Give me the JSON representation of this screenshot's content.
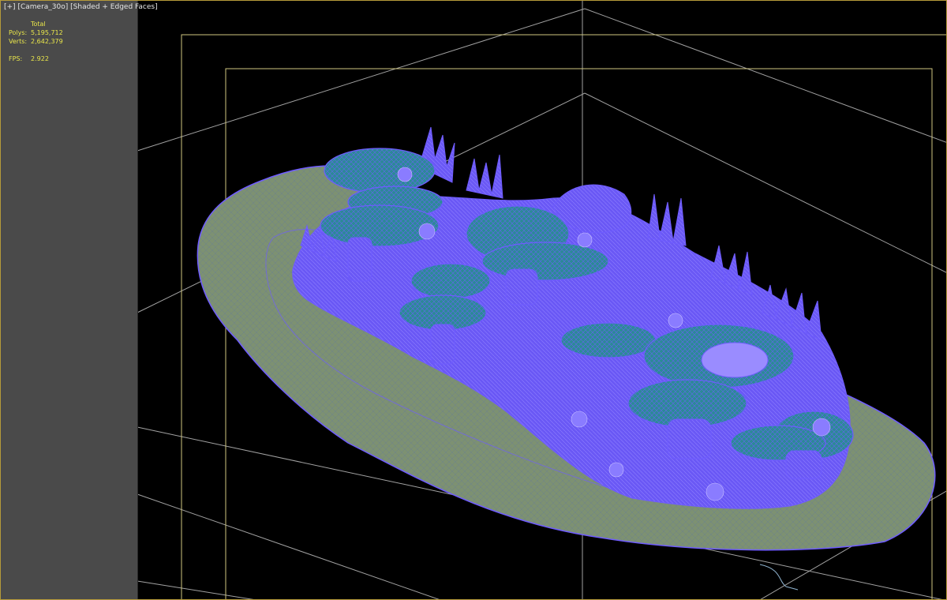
{
  "viewport_label": {
    "plus": "[+]",
    "camera": "[Camera_30o]",
    "shading": "[Shaded + Edged Faces]"
  },
  "stats": {
    "header": "Total",
    "polys_label": "Polys:",
    "polys_value": "5,195,712",
    "verts_label": "Verts:",
    "verts_value": "2,642,379",
    "fps_label": "FPS:",
    "fps_value": "2.922"
  },
  "colors": {
    "panel_bg": "#4a4a4a",
    "viewport_bg": "#000000",
    "wire_purple": "#6f5cff",
    "safe_frame": "#cfc680",
    "grid_line": "#d8d8d8",
    "stats_text": "#e9e64a",
    "label_text": "#e6e6e6",
    "sand": "#7f9374",
    "teal_cap": "#2d8f99"
  }
}
